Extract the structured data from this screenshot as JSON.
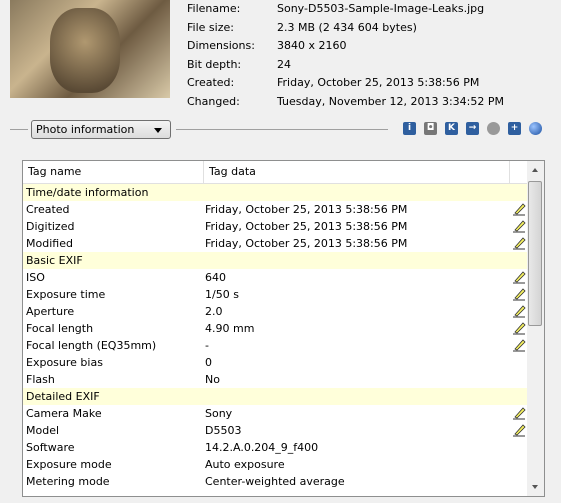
{
  "file_info": [
    {
      "label": "Filename:",
      "value": "Sony-D5503-Sample-Image-Leaks.jpg"
    },
    {
      "label": "File size:",
      "value": "2.3 MB (2 434 604 bytes)"
    },
    {
      "label": "Dimensions:",
      "value": "3840 x 2160"
    },
    {
      "label": "Bit depth:",
      "value": "24"
    },
    {
      "label": "Created:",
      "value": "Friday, October 25, 2013 5:38:56 PM"
    },
    {
      "label": "Changed:",
      "value": "Tuesday, November 12, 2013 3:34:52 PM"
    }
  ],
  "view_select": {
    "value": "Photo information"
  },
  "toolbar": [
    "info-icon",
    "camera-icon",
    "k-icon",
    "arrow-right-icon",
    "globe-gray-icon",
    "plus-icon",
    "globe-icon"
  ],
  "table": {
    "columns": [
      "Tag name",
      "Tag data"
    ],
    "rows": [
      {
        "group": true,
        "name": "Time/date information"
      },
      {
        "name": "Created",
        "data": "Friday, October 25, 2013 5:38:56 PM",
        "edit": true
      },
      {
        "name": "Digitized",
        "data": "Friday, October 25, 2013 5:38:56 PM",
        "edit": true
      },
      {
        "name": "Modified",
        "data": "Friday, October 25, 2013 5:38:56 PM",
        "edit": true
      },
      {
        "group": true,
        "name": "Basic EXIF"
      },
      {
        "name": "ISO",
        "data": "640",
        "edit": true
      },
      {
        "name": "Exposure time",
        "data": "1/50 s",
        "edit": true
      },
      {
        "name": "Aperture",
        "data": "2.0",
        "edit": true
      },
      {
        "name": "Focal length",
        "data": "4.90 mm",
        "edit": true
      },
      {
        "name": "Focal length (EQ35mm)",
        "data": "-",
        "edit": true
      },
      {
        "name": "Exposure bias",
        "data": "0"
      },
      {
        "name": "Flash",
        "data": "No"
      },
      {
        "group": true,
        "name": "Detailed EXIF"
      },
      {
        "name": "Camera Make",
        "data": "Sony",
        "edit": true
      },
      {
        "name": "Model",
        "data": "D5503",
        "edit": true
      },
      {
        "name": "Software",
        "data": "14.2.A.0.204_9_f400"
      },
      {
        "name": "Exposure mode",
        "data": "Auto exposure"
      },
      {
        "name": "Metering mode",
        "data": "Center-weighted average"
      }
    ]
  }
}
